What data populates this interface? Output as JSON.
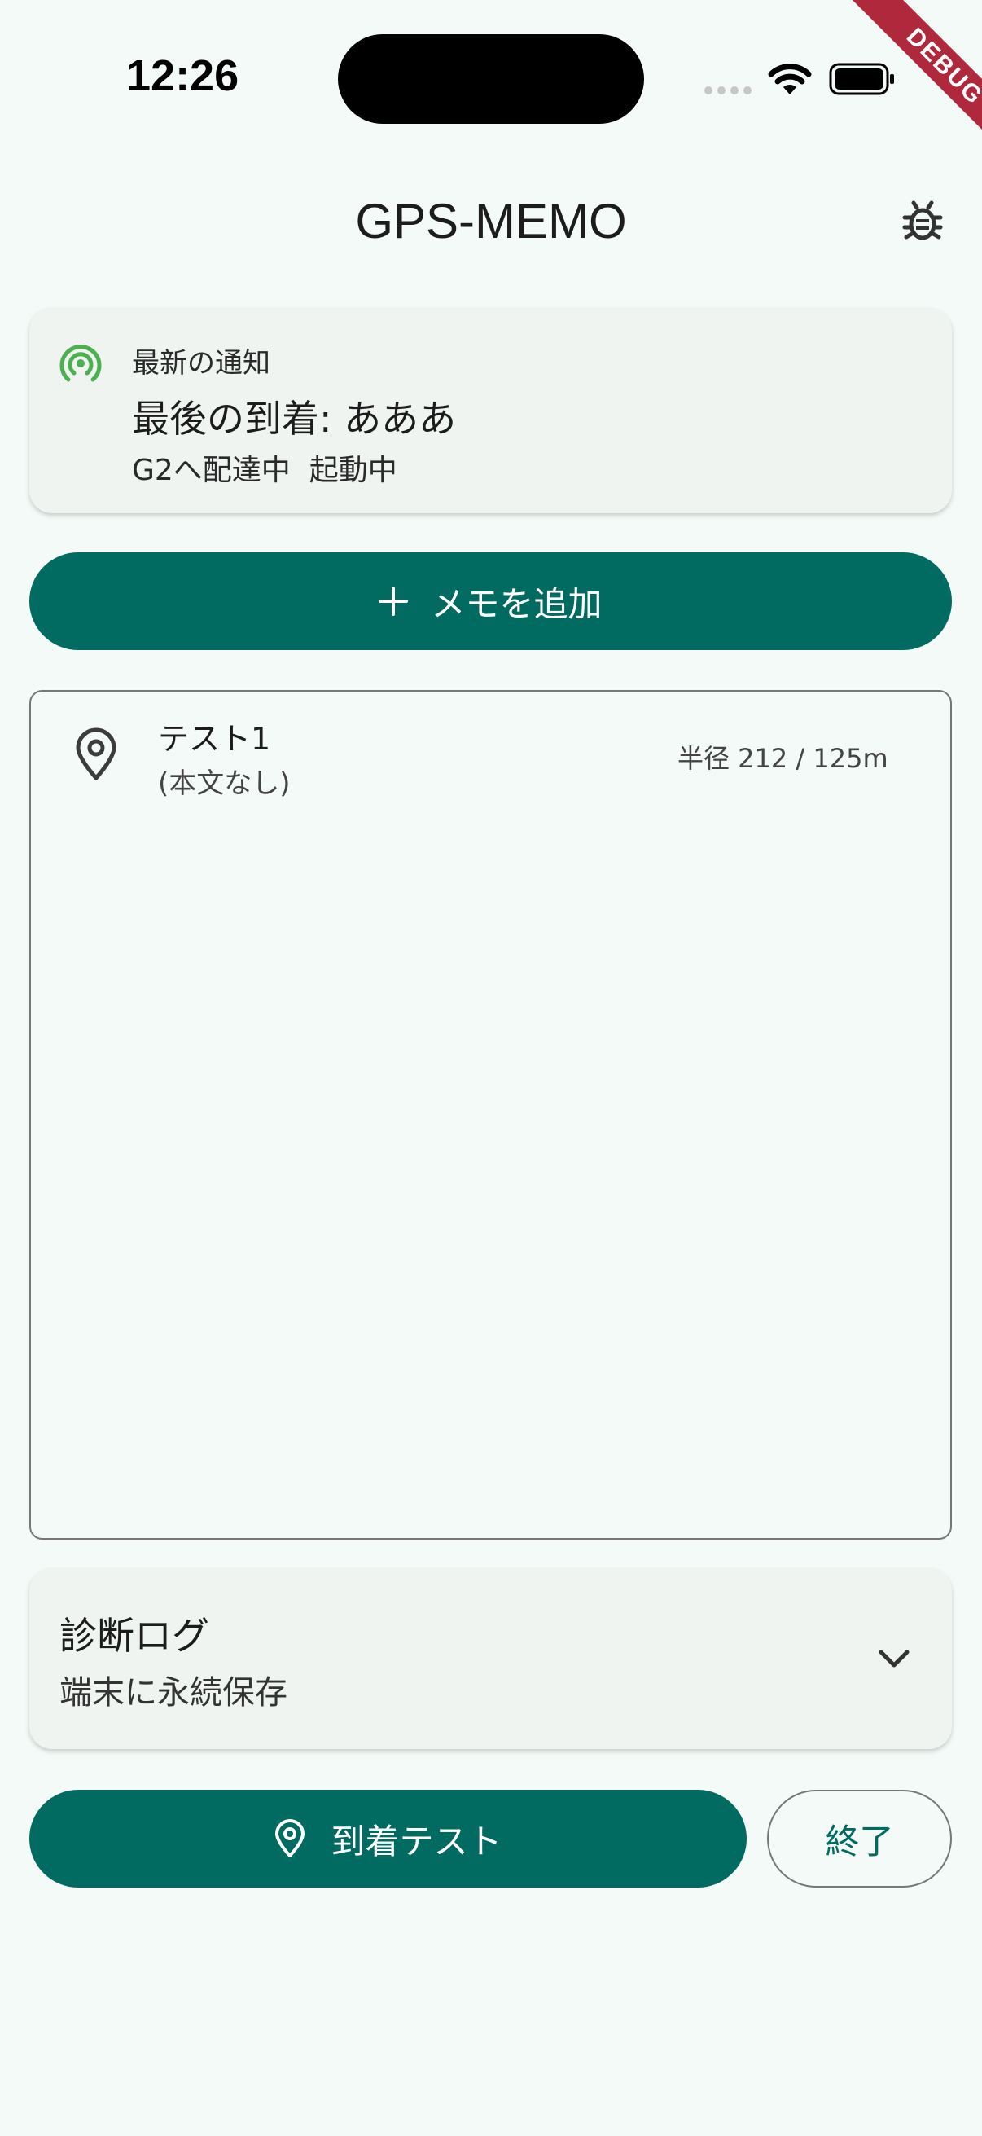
{
  "status_bar": {
    "time": "12:26",
    "icons": [
      "signal-dots-icon",
      "wifi-icon",
      "battery-icon"
    ]
  },
  "debug_banner": "DEBUG",
  "app_bar": {
    "title": "GPS-MEMO",
    "action_icon": "bug-icon"
  },
  "notification": {
    "label": "最新の通知",
    "title": "最後の到着: あああ",
    "status": "G2へ配達中  起動中",
    "icon": "broadcast-icon",
    "icon_color": "#4caf50"
  },
  "add_button": {
    "label": "メモを追加",
    "icon": "plus-icon"
  },
  "memos": [
    {
      "title": "テスト1",
      "body": "(本文なし)",
      "radius": "半径 212 / 125m",
      "icon": "location-pin-icon"
    }
  ],
  "diagnostic": {
    "title": "診断ログ",
    "subtitle": "端末に永続保存",
    "icon": "chevron-down-icon"
  },
  "bottom": {
    "arrive_label": "到着テスト",
    "end_label": "終了"
  },
  "colors": {
    "primary": "#016b62",
    "background": "#f4faf7",
    "card": "#eff4f1",
    "debug": "#b0283b"
  }
}
